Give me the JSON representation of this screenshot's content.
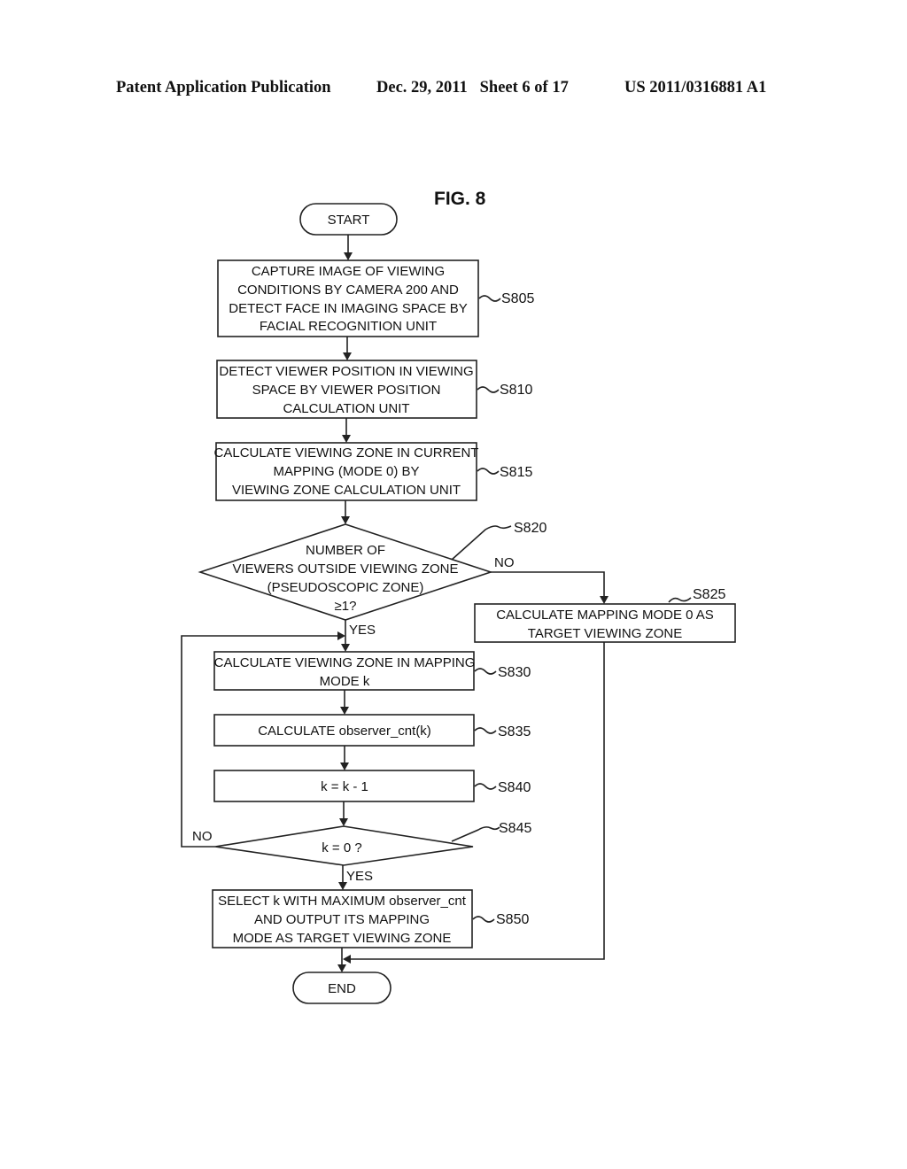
{
  "header": {
    "publication": "Patent Application Publication",
    "date_sheet": "Dec. 29, 2011   Sheet 6 of 17",
    "number": "US 2011/0316881 A1"
  },
  "figure": {
    "title": "FIG. 8",
    "start": "START",
    "end": "END",
    "steps": {
      "s805": {
        "id": "S805",
        "lines": [
          "CAPTURE IMAGE OF VIEWING",
          "CONDITIONS BY CAMERA 200 AND",
          "DETECT FACE IN IMAGING SPACE BY",
          "FACIAL RECOGNITION UNIT"
        ]
      },
      "s810": {
        "id": "S810",
        "lines": [
          "DETECT VIEWER POSITION IN VIEWING",
          "SPACE BY VIEWER POSITION",
          "CALCULATION UNIT"
        ]
      },
      "s815": {
        "id": "S815",
        "lines": [
          "CALCULATE VIEWING ZONE IN CURRENT",
          "MAPPING (MODE 0) BY",
          "VIEWING ZONE CALCULATION UNIT"
        ]
      },
      "s820": {
        "id": "S820",
        "lines": [
          "NUMBER OF",
          "VIEWERS OUTSIDE VIEWING ZONE",
          "(PSEUDOSCOPIC ZONE)",
          "≥1?"
        ],
        "yes": "YES",
        "no": "NO"
      },
      "s825": {
        "id": "S825",
        "lines": [
          "CALCULATE MAPPING MODE 0 AS",
          "TARGET VIEWING ZONE"
        ]
      },
      "s830": {
        "id": "S830",
        "lines": [
          "CALCULATE VIEWING ZONE IN MAPPING",
          "MODE k"
        ]
      },
      "s835": {
        "id": "S835",
        "lines": [
          "CALCULATE observer_cnt(k)"
        ]
      },
      "s840": {
        "id": "S840",
        "lines": [
          "k = k - 1"
        ]
      },
      "s845": {
        "id": "S845",
        "lines": [
          "k = 0 ?"
        ],
        "yes": "YES",
        "no": "NO"
      },
      "s850": {
        "id": "S850",
        "lines": [
          "SELECT k WITH MAXIMUM observer_cnt",
          "AND OUTPUT ITS MAPPING",
          "MODE AS TARGET VIEWING ZONE"
        ]
      }
    }
  }
}
